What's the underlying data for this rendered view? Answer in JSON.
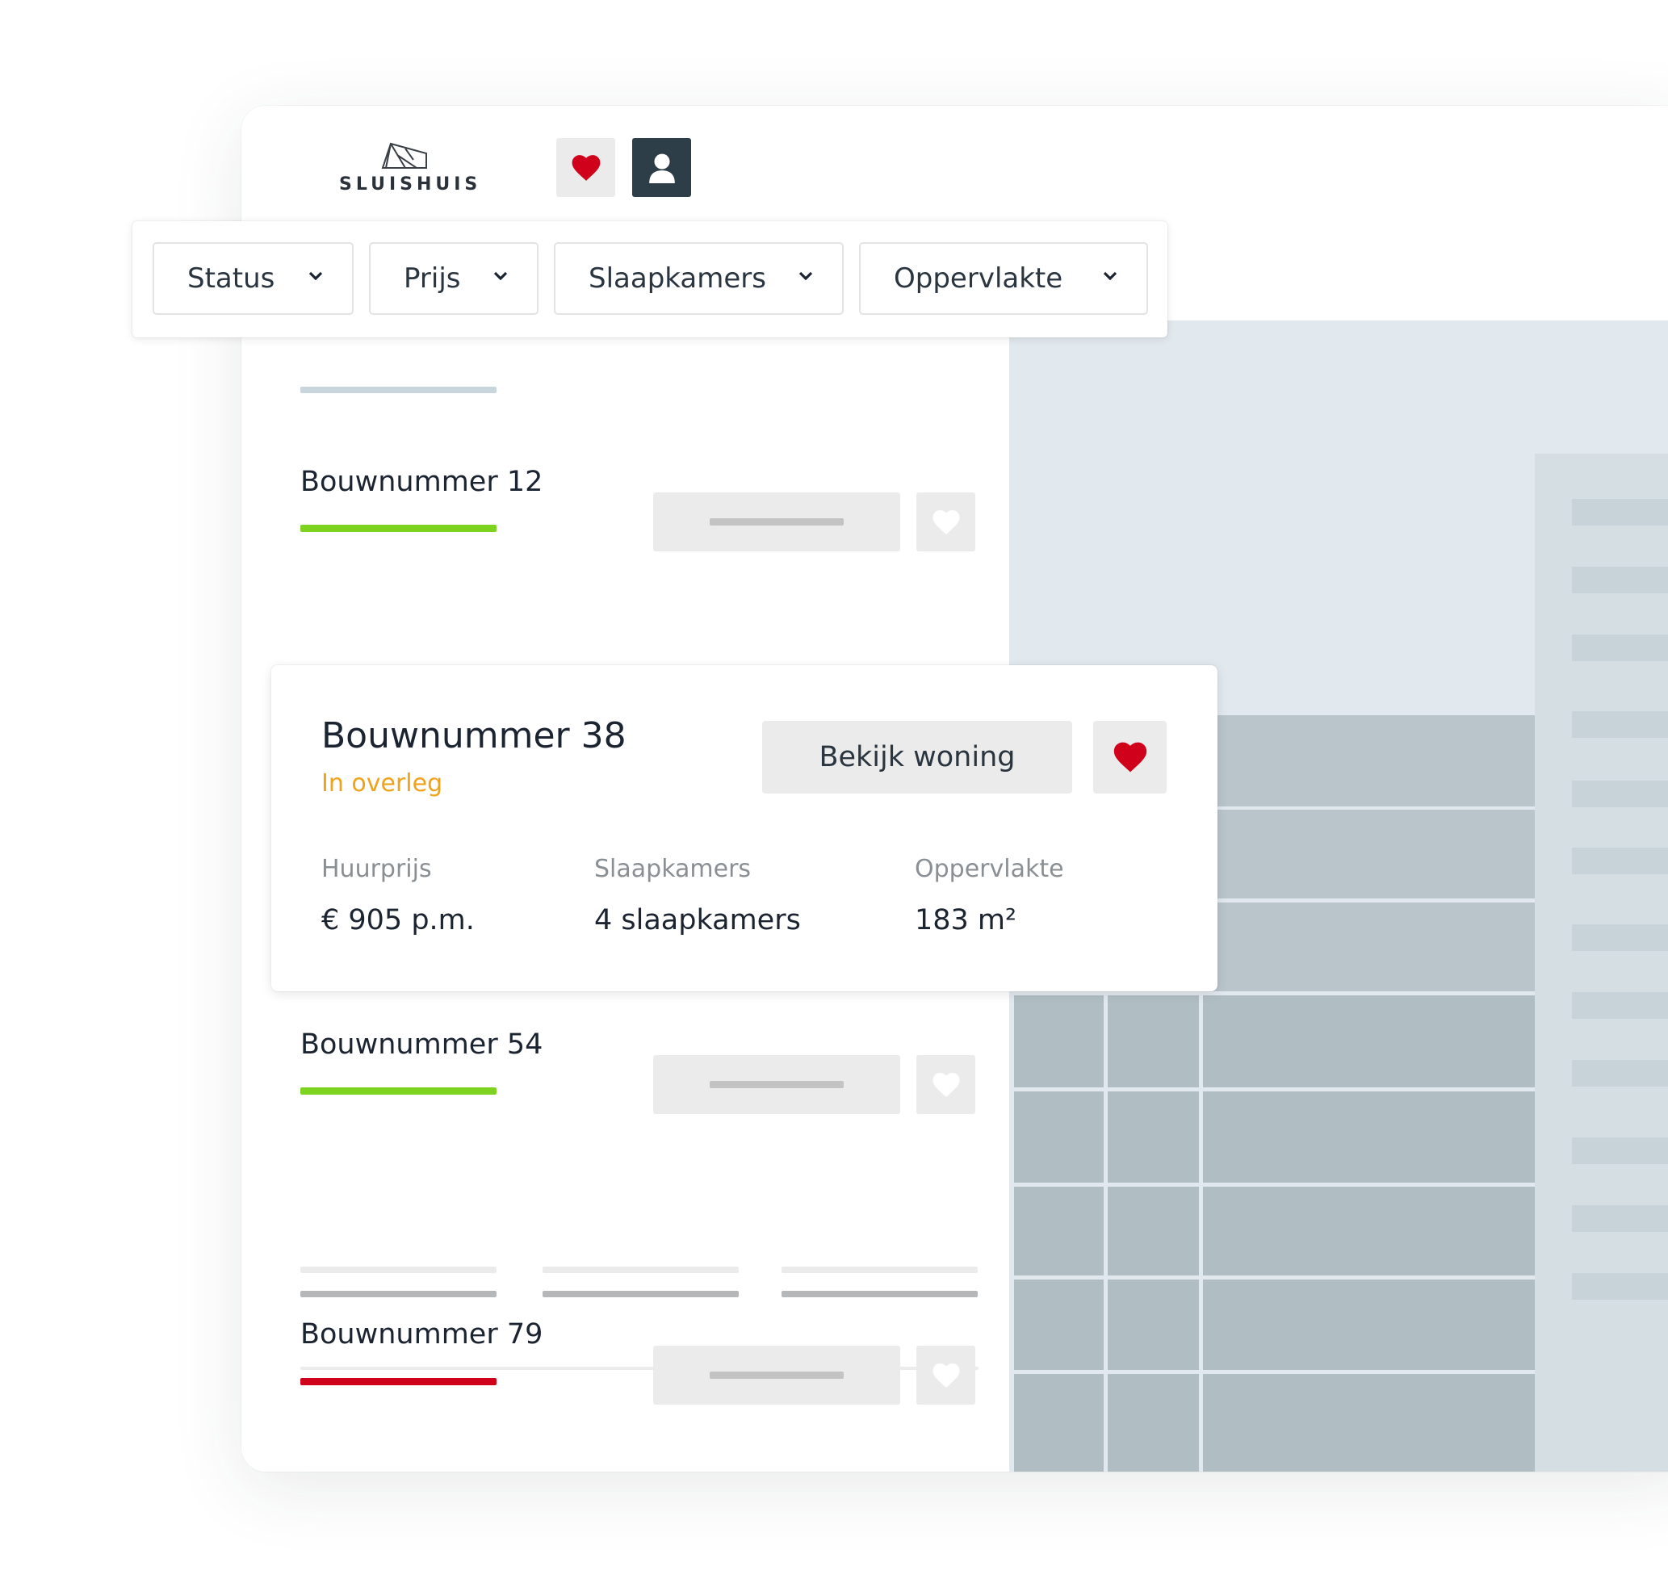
{
  "brand": {
    "logo_text": "SLUISHUIS"
  },
  "filters": [
    {
      "label": "Status"
    },
    {
      "label": "Prijs"
    },
    {
      "label": "Slaapkamers"
    },
    {
      "label": "Oppervlakte"
    }
  ],
  "listings": [
    {
      "title": "Bouwnummer 12",
      "status_color": "#7ed321"
    },
    {
      "title": "Bouwnummer 54",
      "status_color": "#7ed321"
    },
    {
      "title": "Bouwnummer 79",
      "status_color": "#d0021b"
    }
  ],
  "featured": {
    "title": "Bouwnummer 38",
    "status": "In overleg",
    "status_color": "#f0a21a",
    "view_button": "Bekijk woning",
    "specs": [
      {
        "label": "Huurprijs",
        "value": "€ 905 p.m."
      },
      {
        "label": "Slaapkamers",
        "value": "4 slaapkamers"
      },
      {
        "label": "Oppervlakte",
        "value": "183 m²"
      }
    ]
  },
  "colors": {
    "accent_red": "#d0021b",
    "dark": "#2d3e48",
    "pending": "#f0a21a",
    "available": "#7ed321"
  }
}
